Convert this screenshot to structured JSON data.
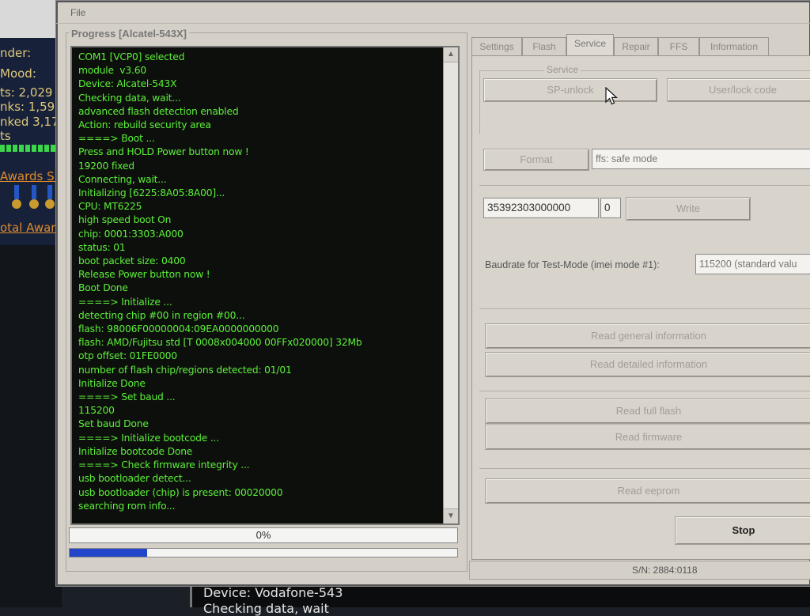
{
  "background_forum": {
    "lines": [
      "nder:",
      "Mood:",
      "ts: 2,029",
      "nks: 1,59",
      "nked 3,17",
      "ts"
    ],
    "awards_link": "Awards Sho",
    "total_awards_link": "otal Award"
  },
  "background_console": {
    "line1": "Device: Vodafone-543",
    "line2": "Checking data, wait"
  },
  "menu": {
    "file": "File"
  },
  "progress_group": {
    "title": "Progress [Alcatel-543X]",
    "log": [
      "COM1 [VCP0] selected",
      "module  v3.60",
      "Device: Alcatel-543X",
      "Checking data, wait...",
      "advanced flash detection enabled",
      "Action: rebuild security area",
      "====> Boot ...",
      "Press and HOLD Power button now !",
      "19200 fixed",
      "Connecting, wait...",
      "Initializing [6225:8A05:8A00]...",
      "CPU: MT6225",
      "high speed boot On",
      "chip: 0001:3303:A000",
      "status: 01",
      "boot packet size: 0400",
      "Release Power button now !",
      "Boot Done",
      "====> Initialize ...",
      "detecting chip #00 in region #00...",
      "flash: 98006F00000004:09EA0000000000",
      "flash: AMD/Fujitsu std [T 0008x004000 00FFx020000] 32Mb",
      "otp offset: 01FE0000",
      "number of flash chip/regions detected: 01/01",
      "Initialize Done",
      "====> Set baud ...",
      "115200",
      "Set baud Done",
      "====> Initialize bootcode ...",
      "Initialize bootcode Done",
      "====> Check firmware integrity ...",
      "usb bootloader detect...",
      "usb bootloader (chip) is present: 00020000",
      "searching rom info..."
    ],
    "percent_text": "0%",
    "progress_fraction": 0.2
  },
  "tabs": [
    {
      "label": "Settings"
    },
    {
      "label": "Flash"
    },
    {
      "label": "Service"
    },
    {
      "label": "Repair"
    },
    {
      "label": "FFS"
    },
    {
      "label": "Information"
    }
  ],
  "service": {
    "legend": "Service",
    "sp_unlock": "SP-unlock",
    "user_lock_code": "User/lock code",
    "format": "Format",
    "ffs_mode_value": "ffs: safe mode",
    "imei_value": "35392303000000",
    "imei_digit_value": "0",
    "write": "Write",
    "baudrate_label": "Baudrate for Test-Mode (imei mode #1):",
    "baudrate_value": "115200 (standard valu",
    "read_general_info": "Read general information",
    "read_detailed_info": "Read detailed information",
    "read_full_flash": "Read full flash",
    "read_firmware": "Read firmware",
    "read_eeprom": "Read eeprom",
    "stop": "Stop"
  },
  "status_bar": {
    "serial": "S/N: 2884:0118"
  },
  "colors": {
    "log_text": "#5cf03a",
    "progress_fill": "#2345c9",
    "window_bg": "#d4d0c8"
  },
  "icons": {
    "scroll_up": "chevron-up-icon",
    "scroll_down": "chevron-down-icon",
    "pointer": "mouse-pointer-icon"
  }
}
